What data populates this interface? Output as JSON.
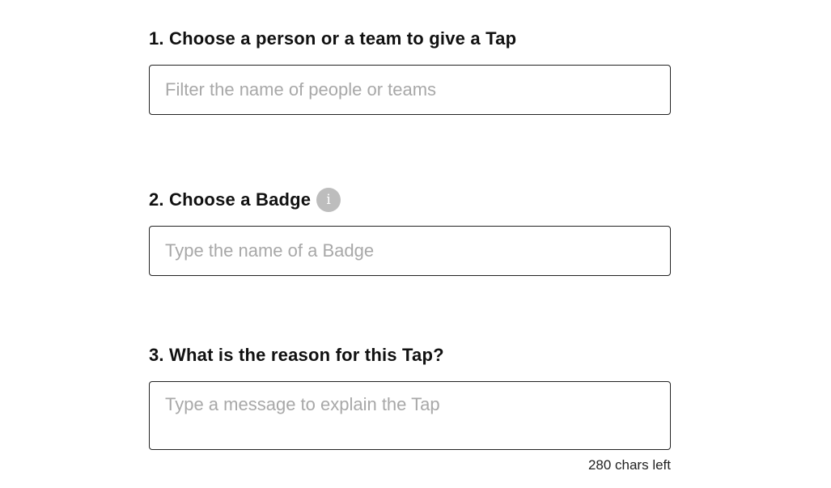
{
  "steps": [
    {
      "title": "1. Choose a person or a team to give a Tap",
      "input_placeholder": "Filter the name of people or teams",
      "input_value": ""
    },
    {
      "title": "2. Choose a Badge",
      "info_icon": "i",
      "input_placeholder": "Type the name of a Badge",
      "input_value": ""
    },
    {
      "title": "3. What is the reason for this Tap?",
      "input_placeholder": "Type a message to explain the Tap",
      "input_value": "",
      "char_counter": "280 chars left"
    }
  ],
  "icons": {
    "badge_info": "info-icon"
  },
  "colors": {
    "placeholder": "#a8a8a8",
    "border": "#222222",
    "info_icon_bg": "#bdbdbd"
  }
}
